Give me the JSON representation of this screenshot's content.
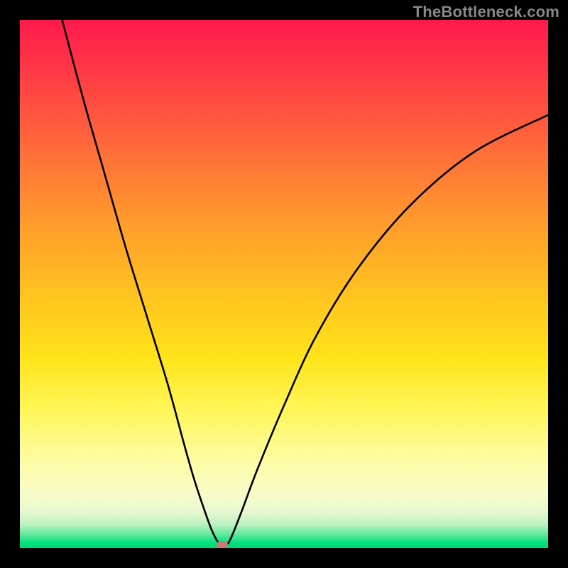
{
  "watermark": "TheBottleneck.com",
  "colors": {
    "frame": "#000000",
    "curve": "#000000",
    "marker": "#c97a74",
    "gradient_stops": [
      "#ff1a4d",
      "#ff6a3a",
      "#ffc31f",
      "#fff65a",
      "#fdfda8",
      "#bdf2c0",
      "#00d878"
    ]
  },
  "chart_data": {
    "type": "line",
    "title": "",
    "xlabel": "",
    "ylabel": "",
    "xlim": [
      0,
      100
    ],
    "ylim": [
      0,
      100
    ],
    "annotations": [],
    "series": [
      {
        "name": "bottleneck-curve",
        "x": [
          8,
          12,
          16,
          20,
          24,
          28,
          31,
          33,
          35,
          36.5,
          38,
          39,
          40,
          42,
          45,
          50,
          56,
          64,
          74,
          86,
          100
        ],
        "values": [
          100,
          85,
          71,
          57,
          44,
          31,
          20,
          13,
          7,
          3,
          0.5,
          0.5,
          2,
          7,
          15,
          27,
          40,
          53,
          65,
          75,
          82
        ]
      }
    ],
    "marker": {
      "x": 38.3,
      "y": 0.6
    }
  }
}
